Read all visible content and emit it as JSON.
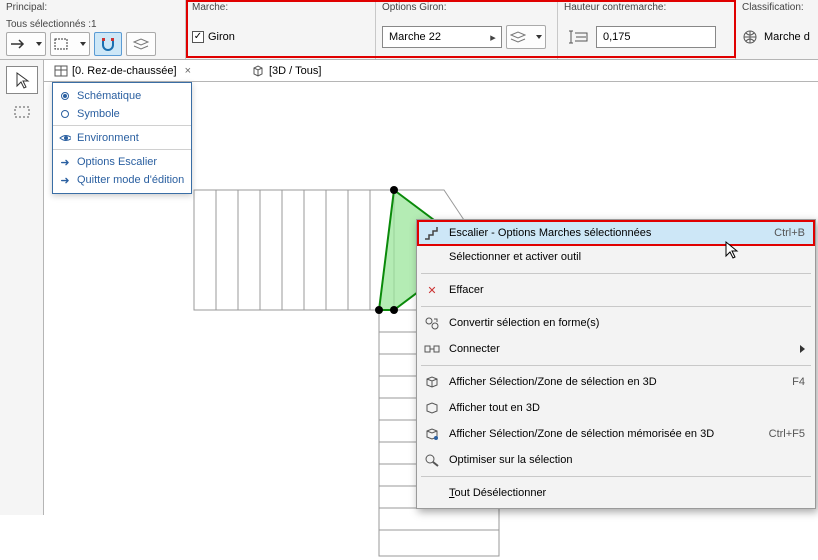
{
  "topbar": {
    "principal_label": "Principal:",
    "selected_count": "Tous sélectionnés :1",
    "marche_label": "Marche:",
    "giron_checkbox": "Giron",
    "options_giron_label": "Options Giron:",
    "giron_value": "Marche 22",
    "hauteur_label": "Hauteur contremarche:",
    "hauteur_value": "0,175",
    "classification_label": "Classification:",
    "classification_value": "Marche d"
  },
  "tabs": {
    "plan": "[0. Rez-de-chaussée]",
    "view3d": "[3D / Tous]"
  },
  "popup": {
    "items": [
      {
        "label": "Schématique",
        "radio": true,
        "on": true
      },
      {
        "label": "Symbole",
        "radio": true,
        "on": false,
        "sep": true
      },
      {
        "label": "Environment",
        "eye": true,
        "sep": true
      },
      {
        "label": "Options Escalier",
        "arrow": true
      },
      {
        "label": "Quitter mode d'édition",
        "arrow": true
      }
    ]
  },
  "ctx": {
    "rows": [
      {
        "icon": "stair",
        "label": "Escalier - Options Marches sélectionnées",
        "shortcut": "Ctrl+B",
        "hl": true
      },
      {
        "label": "Sélectionner et activer outil"
      },
      {
        "sep": true
      },
      {
        "icon": "x",
        "label": "Effacer"
      },
      {
        "sep": true
      },
      {
        "icon": "convert",
        "label": "Convertir sélection en forme(s)"
      },
      {
        "icon": "connect",
        "label": "Connecter",
        "sub": true
      },
      {
        "sep": true
      },
      {
        "icon": "view3d",
        "label": "Afficher Sélection/Zone de sélection en 3D",
        "shortcut": "F4"
      },
      {
        "icon": "all3d",
        "label": "Afficher tout en 3D"
      },
      {
        "icon": "mem3d",
        "label": "Afficher Sélection/Zone de sélection mémorisée en 3D",
        "shortcut": "Ctrl+F5"
      },
      {
        "icon": "opt",
        "label": "Optimiser sur la sélection"
      },
      {
        "sep": true
      },
      {
        "label": "Tout Désélectionner",
        "underline": "T"
      }
    ]
  }
}
